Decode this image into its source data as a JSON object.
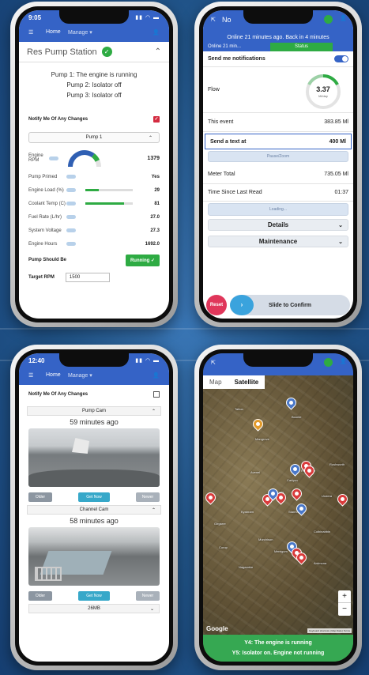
{
  "phone1": {
    "status_time": "9:05",
    "menu_home": "Home",
    "menu_manage": "Manage",
    "station_title": "Res Pump Station",
    "pumps": [
      "Pump 1: The engine is running",
      "Pump 2: Isolator off",
      "Pump 3: Isolator off"
    ],
    "notify_label": "Notify Me Of Any Changes",
    "pump_select": "Pump 1",
    "gauge": {
      "label": "Engine RPM",
      "value": "1379"
    },
    "metrics": [
      {
        "label": "Pump Primed",
        "value": "Yes"
      },
      {
        "label": "Engine Load (%)",
        "value": "29",
        "level": 0.29
      },
      {
        "label": "Coolant Temp (C)",
        "value": "81",
        "level": 0.81
      },
      {
        "label": "Fuel Rate (L/hr)",
        "value": "27.0"
      },
      {
        "label": "System Voltage",
        "value": "27.3"
      },
      {
        "label": "Engine Hours",
        "value": "1692.0"
      }
    ],
    "should_be_label": "Pump Should Be",
    "should_be_value": "Running",
    "target_label": "Target RPM",
    "target_value": "1500"
  },
  "phone2": {
    "title_partial": "No",
    "banner": "Online 21 minutes ago. Back in 4 minutes",
    "tab_online": "Online 21 min...",
    "tab_status": "Status",
    "send_notifications": "Send me notifications",
    "flow_label": "Flow",
    "flow_value": "3.37",
    "flow_unit": "Ml/day",
    "this_event_label": "This event",
    "this_event_value": "383.85 Ml",
    "send_text_label": "Send a text at",
    "send_text_value": "400 Ml",
    "pause_label": "Pause/Zoom",
    "meter_total_label": "Meter Total",
    "meter_total_value": "735.05 Ml",
    "since_read_label": "Time Since Last Read",
    "since_read_value": "01:37",
    "loading_label": "Loading...",
    "details": "Details",
    "maintenance": "Maintenance",
    "reset": "Reset",
    "slide": "Slide to Confirm"
  },
  "phone3": {
    "status_time": "12:40",
    "menu_home": "Home",
    "menu_manage": "Manage",
    "notify_label": "Notify Me Of Any Changes",
    "cams": [
      {
        "name": "Pump Cam",
        "ago": "59 minutes ago",
        "older": "Older",
        "live": "Get Now",
        "newer": "Newer"
      },
      {
        "name": "Channel Cam",
        "ago": "58 minutes ago",
        "older": "Older",
        "live": "Get Now",
        "newer": "Newer"
      }
    ],
    "size_select": "26MB"
  },
  "phone4": {
    "tab_map": "Map",
    "tab_satellite": "Satellite",
    "places": [
      "Tatton",
      "Boonie",
      "Mangrove",
      "Carlyon",
      "Tongala",
      "Kyabram",
      "Stanhope",
      "Girgarre",
      "Rochester",
      "Undera",
      "Murchison",
      "Merrigum",
      "Colbinabbin",
      "Nagambie",
      "Ardmona",
      "Corop",
      "Rushworth",
      "Avenel"
    ],
    "zoom_in": "+",
    "zoom_out": "−",
    "google": "Google",
    "attribution": "Keyboard shortcuts | Map Data | Terms",
    "alert1": "Y4: The engine is running",
    "alert2": "Y5: Isolator on. Engine not running"
  },
  "colors": {
    "primary": "#3563c6",
    "ok": "#2eab43",
    "alert": "#36a852",
    "reset": "#e0365a",
    "marker": "#d93b3b"
  }
}
